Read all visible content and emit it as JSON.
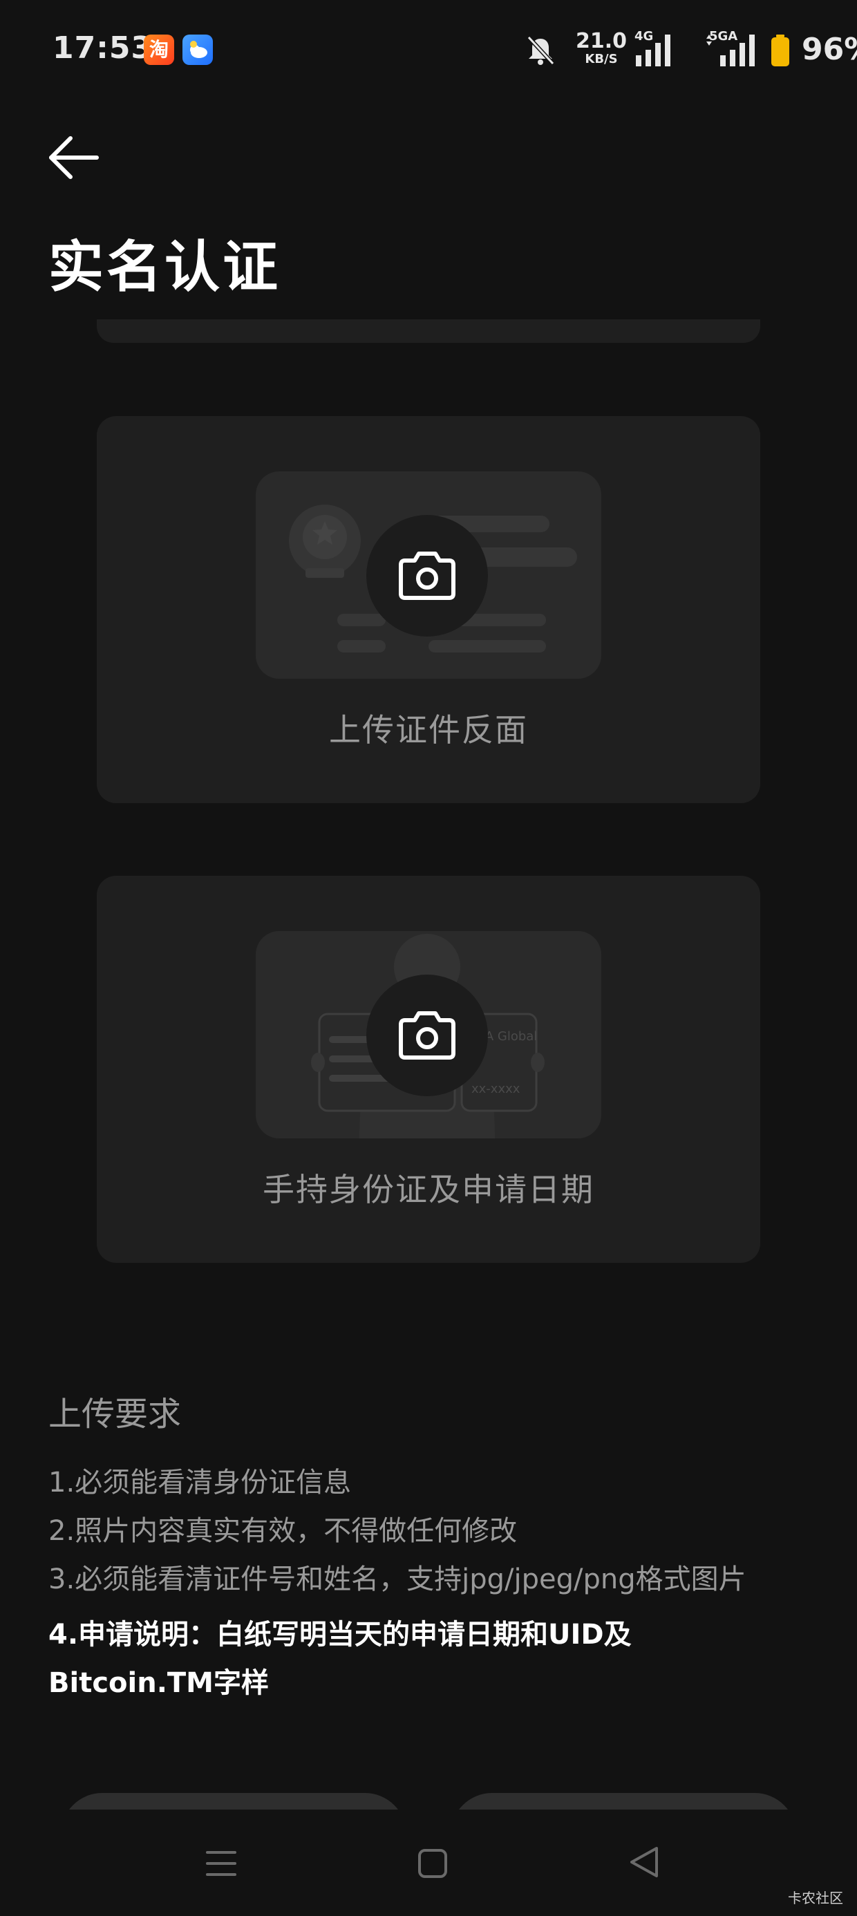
{
  "status_bar": {
    "time": "17:53",
    "taobao_icon_glyph": "淘",
    "speed_value": "21.0",
    "speed_unit": "KB/S",
    "net1_label": "4G",
    "net2_label": "5GA",
    "battery_percent": "96%",
    "icons": [
      "taobao-app-icon",
      "weather-app-icon",
      "bell-muted-icon",
      "signal-4g-icon",
      "signal-5ga-icon",
      "battery-icon"
    ]
  },
  "header": {
    "back_icon": "arrow-left-icon",
    "title": "实名认证"
  },
  "cards": [
    {
      "label": "上传证件反面",
      "illustration": "id-card-back-illustration",
      "icon": "camera-icon"
    },
    {
      "label": "手持身份证及申请日期",
      "illustration": "holding-id-card-illustration",
      "icon": "camera-icon",
      "illustration_text": {
        "brand": "BKA Global",
        "placeholder": "xx-xxxx"
      }
    }
  ],
  "requirements": {
    "title": "上传要求",
    "items": [
      "1.必须能看清身份证信息",
      "2.照片内容真实有效，不得做任何修改",
      "3.必须能看清证件号和姓名，支持jpg/jpeg/png格式图片",
      "4.申请说明：白纸写明当天的申请日期和UID及Bitcoin.TM字样"
    ]
  },
  "nav_bar": {
    "icons": [
      "menu-icon",
      "home-square-icon",
      "back-triangle-icon"
    ]
  },
  "watermark": "卡农社区",
  "colors": {
    "background": "#121212",
    "card": "#1f1f1f",
    "illustration": "#2a2a2a",
    "muted_text": "#9a9a9a",
    "battery": "#f5b800"
  }
}
